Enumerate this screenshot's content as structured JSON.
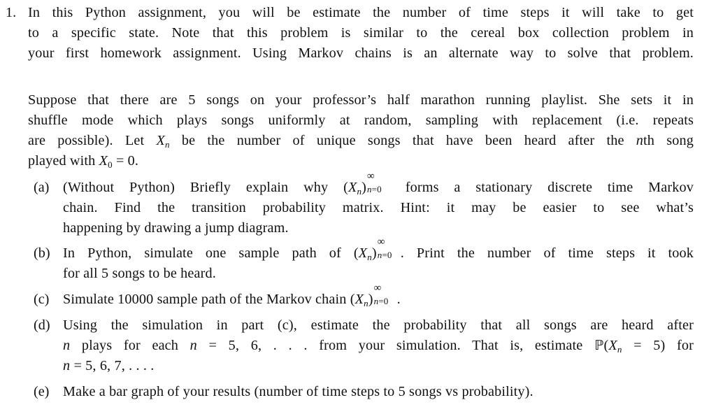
{
  "problem": {
    "number": "1.",
    "intro_lines": [
      "In this Python assignment, you will be estimate the number of time steps it will take to get",
      "to a specific state.  Note that this problem is similar to the cereal box collection problem in",
      "your first homework assignment. Using Markov chains is an alternate way to solve that problem."
    ],
    "setup": {
      "line1": "Suppose that there are 5 songs on your professor’s half marathon running playlist.  She sets it in",
      "line2": "shuffle mode which plays songs uniformly at random, sampling with replacement (i.e.  repeats",
      "line3_pre": "are possible).  Let ",
      "line3_var": "X",
      "line3_sub": "n",
      "line3_mid": " be the number of unique songs that have been heard after the ",
      "line3_n": "n",
      "line3_post": "th song",
      "line4_pre": "played with ",
      "line4_var": "X",
      "line4_sub": "0",
      "line4_post": " = 0."
    },
    "parts": [
      {
        "label": "(a)",
        "line1_pre": "(Without Python) Briefly explain why (",
        "line1_post": " forms a stationary discrete time Markov",
        "line2": "chain.   Find the transition probability matrix.   Hint:  it may be easier to see what’s",
        "line3": "happening by drawing a jump diagram."
      },
      {
        "label": "(b)",
        "line1_pre": "In Python, simulate one sample path of (",
        "line1_post": ".  Print the number of time steps it took",
        "line2": "for all 5 songs to be heard."
      },
      {
        "label": "(c)",
        "line1_pre": "Simulate 10000 sample path of the Markov chain (",
        "line1_post": "."
      },
      {
        "label": "(d)",
        "line1": "Using the simulation in part (c), estimate the probability that all songs are heard after",
        "line2_pre": " plays for each ",
        "line2_mid": " = 5, 6, . . .  from your simulation.  That is, estimate ",
        "line2_P": "ℙ",
        "line2_post": " = 5)  for",
        "line3_post": " = 5, 6, 7, . . . ."
      },
      {
        "label": "(e)",
        "line1": "Make a bar graph of your results (number of time steps to 5 songs vs probability)."
      }
    ],
    "math": {
      "X": "X",
      "n": "n",
      "inf": "∞",
      "neq0": "n=0"
    }
  }
}
